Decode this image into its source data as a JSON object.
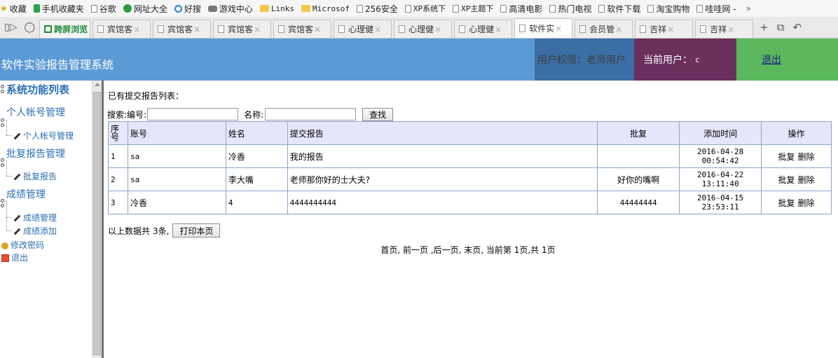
{
  "bookmarks": {
    "items": [
      {
        "label": "收藏",
        "icon": "star-icon"
      },
      {
        "label": "手机收藏夹",
        "icon": "phone-icon"
      },
      {
        "label": "谷歌",
        "icon": "page-icon"
      },
      {
        "label": "网址大全",
        "icon": "globe-icon"
      },
      {
        "label": "好搜",
        "icon": "search-icon"
      },
      {
        "label": "游戏中心",
        "icon": "game-icon"
      },
      {
        "label": "Links",
        "icon": "folder-icon"
      },
      {
        "label": "Microsof",
        "icon": "folder-icon"
      },
      {
        "label": "256安全",
        "icon": "page-icon"
      },
      {
        "label": "XP系统下",
        "icon": "page-icon"
      },
      {
        "label": "XP主题下",
        "icon": "page-icon"
      },
      {
        "label": "高清电影",
        "icon": "page-icon"
      },
      {
        "label": "热门电视",
        "icon": "page-icon"
      },
      {
        "label": "软件下载",
        "icon": "page-icon"
      },
      {
        "label": "淘宝购物",
        "icon": "page-icon"
      },
      {
        "label": "哇哇网 -",
        "icon": "page-icon"
      }
    ],
    "more": "»"
  },
  "tabs": {
    "special": "跨屏浏览",
    "items": [
      {
        "label": "宾馆客",
        "active": false
      },
      {
        "label": "宾馆客",
        "active": false
      },
      {
        "label": "宾馆客",
        "active": false
      },
      {
        "label": "宾馆客",
        "active": false
      },
      {
        "label": "心理健",
        "active": false
      },
      {
        "label": "心理健",
        "active": false
      },
      {
        "label": "心理健",
        "active": false
      },
      {
        "label": "软件实",
        "active": true
      },
      {
        "label": "会员管",
        "active": false
      },
      {
        "label": "吉祥",
        "active": false
      },
      {
        "label": "吉祥",
        "active": false
      }
    ],
    "close_glyph": "×",
    "new_tab": "+"
  },
  "header": {
    "app_title": "软件实验报告管理系统",
    "permission": "用户权限：老师用户",
    "current_user_label": "当前用户：",
    "current_user": "c",
    "logout": "退出",
    "colors": {
      "bar": "#5b9bd5",
      "permission": "#3a6ea5",
      "user": "#6b2f5e",
      "logout": "#5cb85c"
    }
  },
  "sidebar": {
    "title": "系统功能列表",
    "groups": [
      {
        "label": "个人帐号管理",
        "items": [
          "个人帐号管理"
        ]
      },
      {
        "label": "批复报告管理",
        "items": [
          "批复报告"
        ]
      },
      {
        "label": "成绩管理",
        "items": [
          "成绩管理",
          "成绩添加"
        ]
      }
    ],
    "change_password": "修改密码",
    "exit": "退出"
  },
  "main": {
    "list_title": "已有提交报告列表：",
    "search": {
      "label": "搜索:",
      "id_label": "编号:",
      "id_value": "",
      "name_label": "名称:",
      "name_value": "",
      "button": "查找"
    },
    "table": {
      "headers": [
        "序号",
        "账号",
        "姓名",
        "提交报告",
        "批复",
        "添加时间",
        "操作"
      ],
      "rows": [
        {
          "no": "1",
          "account": "sa",
          "name": "冷香",
          "report": "我的报告",
          "reply": "",
          "date": "2016-04-28",
          "time": "00:54:42"
        },
        {
          "no": "2",
          "account": "sa",
          "name": "李大嘴",
          "report": "老师那你好的士大夫?",
          "reply": "好你的嘴啊",
          "date": "2016-04-22",
          "time": "13:11:40"
        },
        {
          "no": "3",
          "account": "冷香",
          "name": "4",
          "report": "4444444444",
          "reply": "44444444",
          "date": "2016-04-15",
          "time": "23:53:11"
        }
      ],
      "actions": {
        "reply": "批复",
        "delete": "删除"
      }
    },
    "summary_prefix": "以上数据共",
    "summary_count": "3条,",
    "print_button": "打印本页",
    "pager": "首页, 前一页 ,后一页, 末页, 当前第 1页,共 1页"
  }
}
